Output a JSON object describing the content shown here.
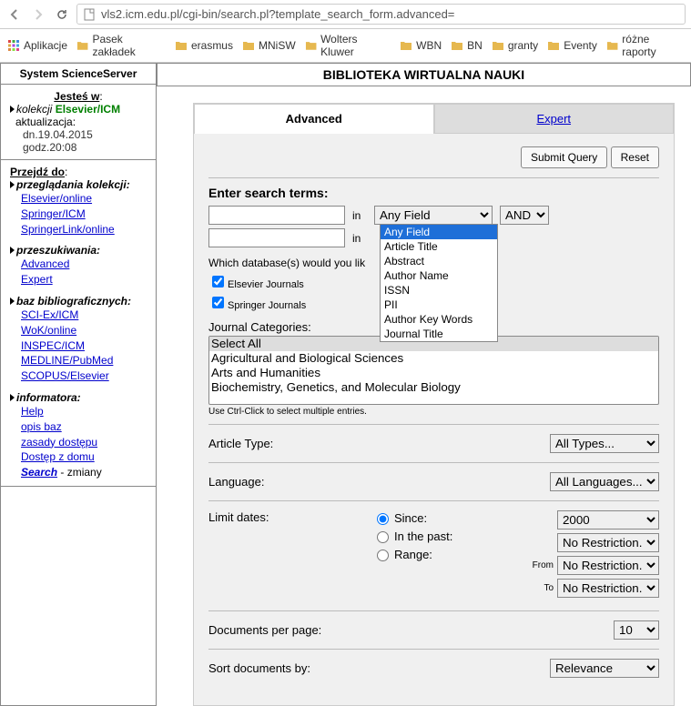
{
  "browser": {
    "url": "vls2.icm.edu.pl/cgi-bin/search.pl?template_search_form.advanced="
  },
  "bookmarks": {
    "apps": "Aplikacje",
    "items": [
      "Pasek zakładek",
      "erasmus",
      "MNiSW",
      "Wolters Kluwer",
      "WBN",
      "BN",
      "granty",
      "Eventy",
      "różne raporty"
    ]
  },
  "sidebar": {
    "header": "System ScienceServer",
    "jestes": "Jesteś w",
    "kolekcji_label": "kolekcji",
    "kolekcji_value": "Elsevier/ICM",
    "aktualizacja": "aktualizacja:",
    "date": "dn.19.04.2015",
    "time": "godz.20:08",
    "przejdz": "Przejdź do",
    "groups": [
      {
        "title": "przeglądania kolekcji:",
        "links": [
          "Elsevier/online",
          "Springer/ICM",
          "SpringerLink/online"
        ]
      },
      {
        "title": "przeszukiwania:",
        "links": [
          "Advanced",
          "Expert"
        ]
      },
      {
        "title": "baz bibliograficznych:",
        "links": [
          "SCI-Ex/ICM",
          "WoK/online",
          "INSPEC/ICM",
          "MEDLINE/PubMed",
          "SCOPUS/Elsevier"
        ]
      },
      {
        "title": "informatora:",
        "links": [
          "Help",
          "opis baz",
          "zasady dostępu",
          "Dostęp z domu"
        ]
      }
    ],
    "search_label": "Search",
    "search_suffix": " - zmiany"
  },
  "content": {
    "title": "BIBLIOTEKA WIRTUALNA NAUKI",
    "tabs": {
      "advanced": "Advanced",
      "expert": "Expert"
    },
    "submit": "Submit Query",
    "reset": "Reset",
    "enter_terms": "Enter search terms:",
    "in": "in",
    "field_select": "Any Field",
    "bool_select": "AND",
    "dropdown_options": [
      "Any Field",
      "Article Title",
      "Abstract",
      "Author Name",
      "ISSN",
      "PII",
      "Author Key Words",
      "Journal Title"
    ],
    "which_db": "Which database(s) would you lik",
    "db1": "Elsevier Journals",
    "db2": "Springer Journals",
    "journal_cat_label": "Journal Categories:",
    "cats": [
      "Select All",
      "Agricultural and Biological Sciences",
      "Arts and Humanities",
      "Biochemistry, Genetics, and Molecular Biology"
    ],
    "ctrl_hint": "Use Ctrl-Click to select multiple entries.",
    "article_type_label": "Article Type:",
    "article_type_value": "All Types...",
    "language_label": "Language:",
    "language_value": "All Languages...",
    "limit_dates_label": "Limit dates:",
    "since": "Since:",
    "in_past": "In the past:",
    "range": "Range:",
    "from": "From",
    "to": "To",
    "year": "2000",
    "no_restriction": "No Restriction...",
    "docs_per_page_label": "Documents per page:",
    "docs_per_page_value": "10",
    "sort_label": "Sort documents by:",
    "sort_value": "Relevance"
  }
}
